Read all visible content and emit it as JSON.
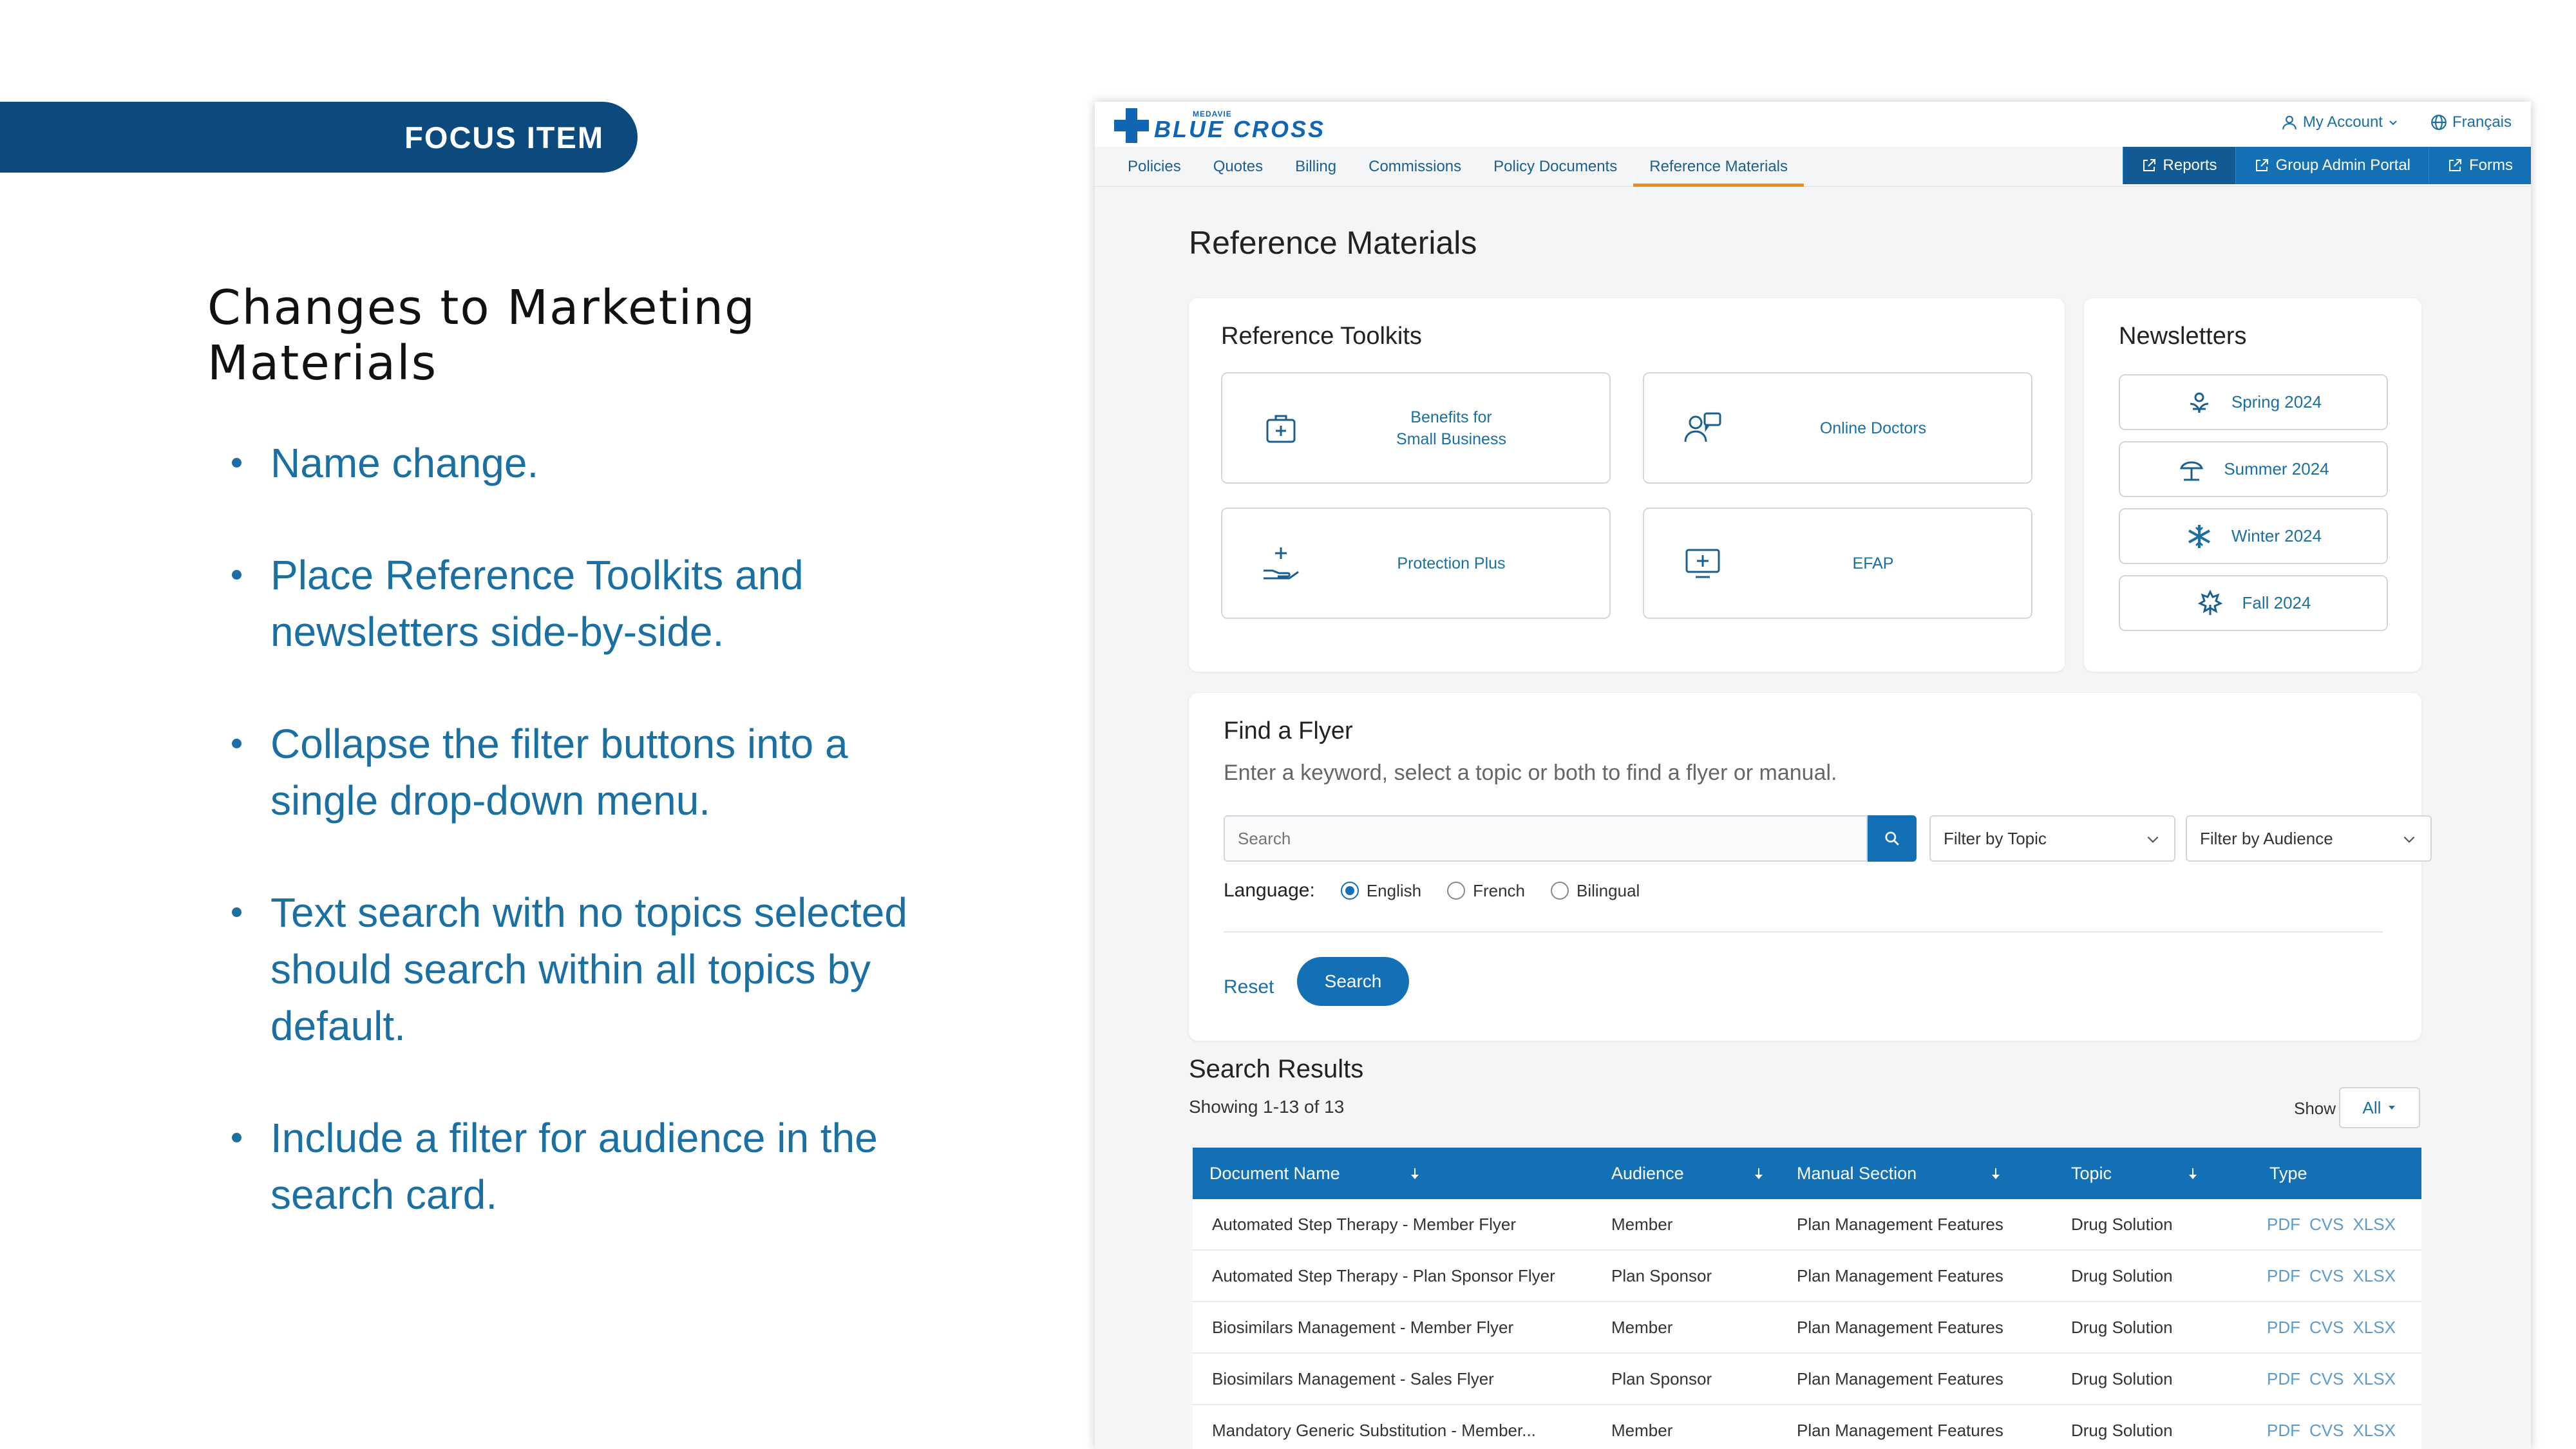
{
  "slide": {
    "tag": "FOCUS ITEM",
    "title_line1": "Changes to Marketing",
    "title_line2": "Materials",
    "bullets": [
      {
        "line1": "Name change.",
        "line2": "",
        "line3": ""
      },
      {
        "line1": "Place Reference Toolkits and",
        "line2": "newsletters side-by-side.",
        "line3": ""
      },
      {
        "line1": "Collapse the filter buttons into a",
        "line2": "single drop-down menu.",
        "line3": ""
      },
      {
        "line1": "Text search with no topics selected",
        "line2": "should search within all topics by",
        "line3": "default."
      },
      {
        "line1": "Include a filter for audience in the",
        "line2": "search card.",
        "line3": ""
      }
    ]
  },
  "app": {
    "logo": {
      "small": "MEDAVIE",
      "main": "BLUE CROSS"
    },
    "top_links": {
      "account": "My Account",
      "language": "Français"
    },
    "nav": [
      "Policies",
      "Quotes",
      "Billing",
      "Commissions",
      "Policy Documents",
      "Reference Materials"
    ],
    "nav_active": "Reference Materials",
    "nav_external": [
      "Reports",
      "Group Admin Portal",
      "Forms"
    ],
    "page_title": "Reference Materials",
    "toolkits": {
      "title": "Reference Toolkits",
      "items": [
        {
          "line1": "Benefits for",
          "line2": "Small Business",
          "icon": "first-aid-kit-icon"
        },
        {
          "line1": "Online Doctors",
          "line2": "",
          "icon": "doctors-icon"
        },
        {
          "line1": "Protection Plus",
          "line2": "",
          "icon": "hand-cross-icon"
        },
        {
          "line1": "EFAP",
          "line2": "",
          "icon": "monitor-cross-icon"
        }
      ]
    },
    "newsletters": {
      "title": "Newsletters",
      "items": [
        {
          "label": "Spring 2024",
          "icon": "flower-icon"
        },
        {
          "label": "Summer 2024",
          "icon": "beach-umbrella-icon"
        },
        {
          "label": "Winter 2024",
          "icon": "snowflake-icon"
        },
        {
          "label": "Fall 2024",
          "icon": "maple-leaf-icon"
        }
      ]
    },
    "flyer": {
      "title": "Find a Flyer",
      "subtitle": "Enter a keyword, select a topic or both to find a flyer or manual.",
      "search_placeholder": "Search",
      "filter_topic": "Filter by Topic",
      "filter_audience": "Filter by Audience",
      "language_label": "Language:",
      "languages": [
        "English",
        "French",
        "Bilingual"
      ],
      "language_selected": "English",
      "reset": "Reset",
      "search_button": "Search"
    },
    "results": {
      "title": "Search Results",
      "count": "Showing 1-13 of 13",
      "show_label": "Show",
      "show_value": "All",
      "columns": [
        "Document Name",
        "Audience",
        "Manual Section",
        "Topic",
        "Type"
      ],
      "rows": [
        {
          "name": "Automated Step Therapy - Member Flyer",
          "audience": "Member",
          "section": "Plan Management Features",
          "topic": "Drug Solution",
          "types": [
            "PDF",
            "CVS",
            "XLSX"
          ]
        },
        {
          "name": "Automated Step Therapy - Plan Sponsor Flyer",
          "audience": "Plan Sponsor",
          "section": "Plan Management Features",
          "topic": "Drug Solution",
          "types": [
            "PDF",
            "CVS",
            "XLSX"
          ]
        },
        {
          "name": "Biosimilars Management - Member Flyer",
          "audience": "Member",
          "section": "Plan Management Features",
          "topic": "Drug Solution",
          "types": [
            "PDF",
            "CVS",
            "XLSX"
          ]
        },
        {
          "name": "Biosimilars Management - Sales Flyer",
          "audience": "Plan Sponsor",
          "section": "Plan Management Features",
          "topic": "Drug Solution",
          "types": [
            "PDF",
            "CVS",
            "XLSX"
          ]
        },
        {
          "name": "Mandatory Generic Substitution - Member...",
          "audience": "Member",
          "section": "Plan Management Features",
          "topic": "Drug Solution",
          "types": [
            "PDF",
            "CVS",
            "XLSX"
          ]
        }
      ]
    }
  }
}
